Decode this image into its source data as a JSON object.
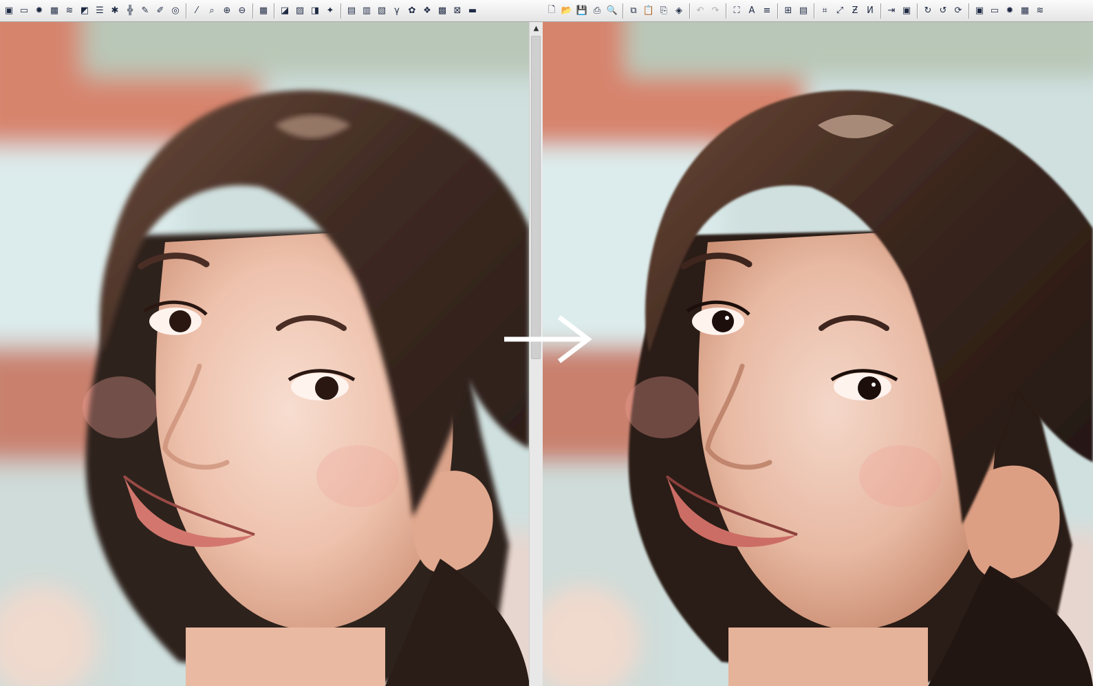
{
  "left_toolbar": {
    "icons": [
      "layer-icon",
      "frame-icon",
      "sun-icon",
      "grid-icon",
      "wave-icon",
      "contrast-icon",
      "stripes-icon",
      "burst-icon",
      "filter-icon",
      "pen-icon",
      "brush-icon",
      "spiral-icon",
      "eyedropper-icon",
      "zoom-dropdown-icon",
      "zoom-in-icon",
      "zoom-out-icon",
      "grid-dropdown-icon",
      "square-icon",
      "gradient-icon",
      "tint-icon",
      "wand-icon",
      "palette-icon",
      "levels-icon",
      "image-icon",
      "gamma-icon",
      "colors-icon",
      "rgb-icon",
      "checker-icon",
      "xor-icon",
      "bar-icon"
    ],
    "glyphs": [
      "▣",
      "▭",
      "✹",
      "▦",
      "≋",
      "◩",
      "☰",
      "✱",
      "╬",
      "✎",
      "✐",
      "◎",
      "⁄",
      "⌕",
      "⊕",
      "⊖",
      "▦",
      "◪",
      "▨",
      "◨",
      "✦",
      "▤",
      "▥",
      "▧",
      "γ",
      "✿",
      "❖",
      "▩",
      "⊠",
      "▬"
    ]
  },
  "right_toolbar": {
    "icons": [
      "new-file-icon",
      "open-folder-icon",
      "save-icon",
      "print-icon",
      "print-preview-icon",
      "copy-icon",
      "paste-icon",
      "paste-special-icon",
      "paint-icon",
      "undo-icon",
      "redo-icon",
      "fit-icon",
      "text-tool-icon",
      "align-icon",
      "tile-icon",
      "panel-icon",
      "crop-icon",
      "resize-icon",
      "flip-icon",
      "mirror-icon",
      "arrow-split-icon",
      "canvas-icon",
      "rotate-90-icon",
      "rotate-270-icon",
      "rotate-icon",
      "layer-icon",
      "frame-icon",
      "sun-icon",
      "grid-icon",
      "wave-icon"
    ],
    "glyphs": [
      "🗋",
      "📂",
      "💾",
      "⎙",
      "🔍",
      "⧉",
      "📋",
      "⎘",
      "◈",
      "↶",
      "↷",
      "⛶",
      "A",
      "≡",
      "⊞",
      "▤",
      "⌗",
      "⤢",
      "Ƶ",
      "И",
      "⇥",
      "▣",
      "↻",
      "↺",
      "⟳",
      "▣",
      "▭",
      "✹",
      "▦",
      "≋"
    ]
  },
  "left_image_label": "",
  "right_image_label": "",
  "colors": {
    "accent": "#ffffff",
    "toolbar": "#f0f0f0"
  }
}
